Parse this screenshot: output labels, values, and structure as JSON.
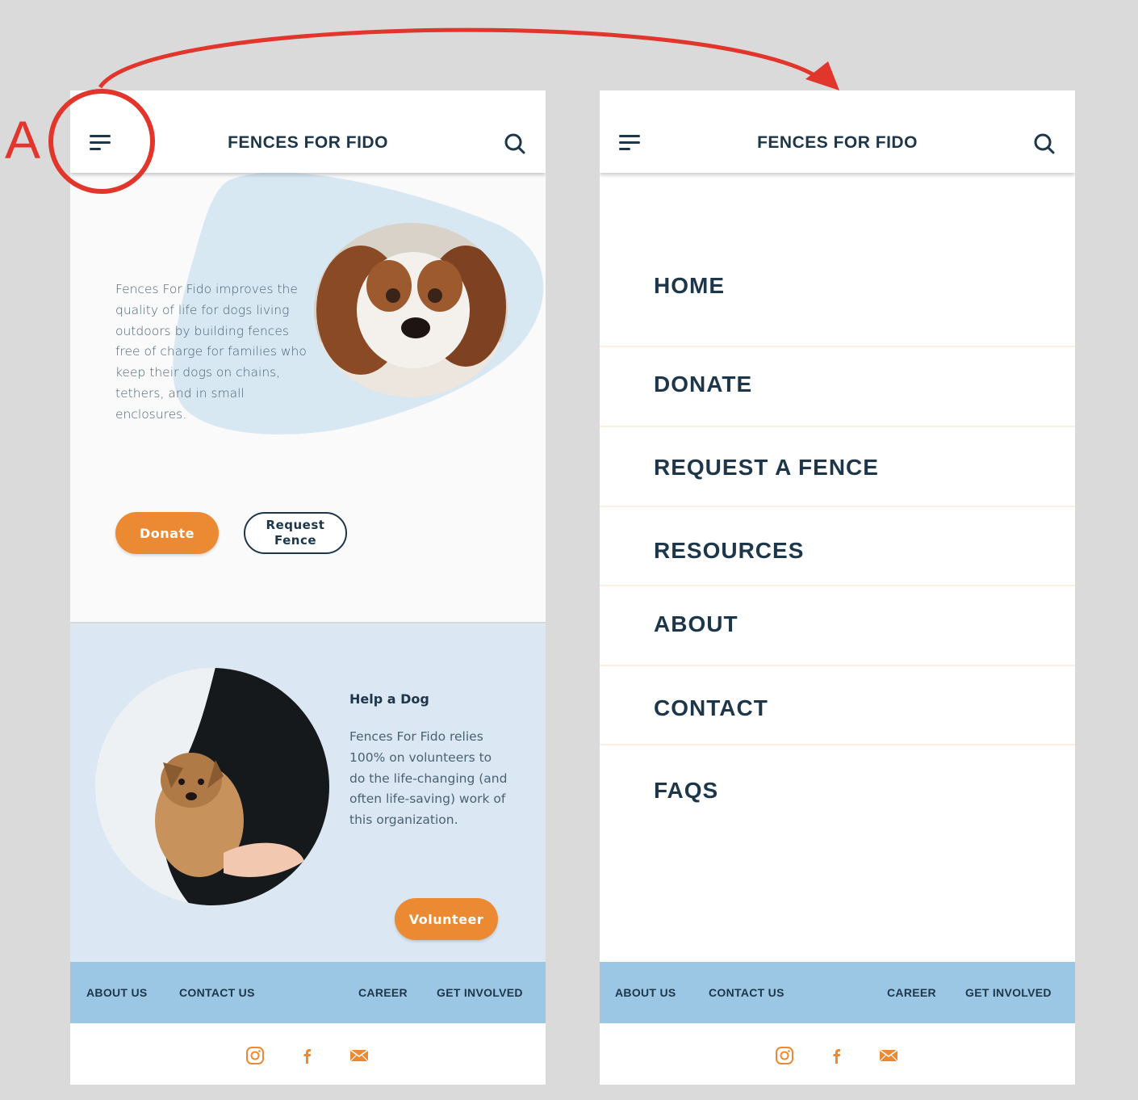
{
  "annotation": {
    "label": "A"
  },
  "header": {
    "title": "FENCES FOR FIDO"
  },
  "hero": {
    "text": "Fences For Fido improves the quality of life for dogs living outdoors by building fences free of charge for families who keep their dogs on chains, tethers, and in small enclosures.",
    "donate_label": "Donate",
    "request_label": "Request Fence"
  },
  "help": {
    "title": "Help a Dog",
    "text": "Fences For Fido relies 100% on volunteers to do the life-changing (and often life-saving) work of this organization.",
    "volunteer_label": "Volunteer"
  },
  "footer": {
    "links": [
      "ABOUT US",
      "CONTACT US",
      "CAREER",
      "GET INVOLVED"
    ],
    "social": [
      "instagram-icon",
      "facebook-icon",
      "mail-icon"
    ]
  },
  "menu": {
    "items": [
      "HOME",
      "DONATE",
      "REQUEST A FENCE",
      "RESOURCES",
      "ABOUT",
      "CONTACT",
      "FAQS"
    ]
  },
  "colors": {
    "navy": "#1d3649",
    "orange": "#ec8a33",
    "light_blue": "#dbe8f3",
    "footer_blue": "#9cc7e4",
    "annotation_red": "#e2352b"
  }
}
